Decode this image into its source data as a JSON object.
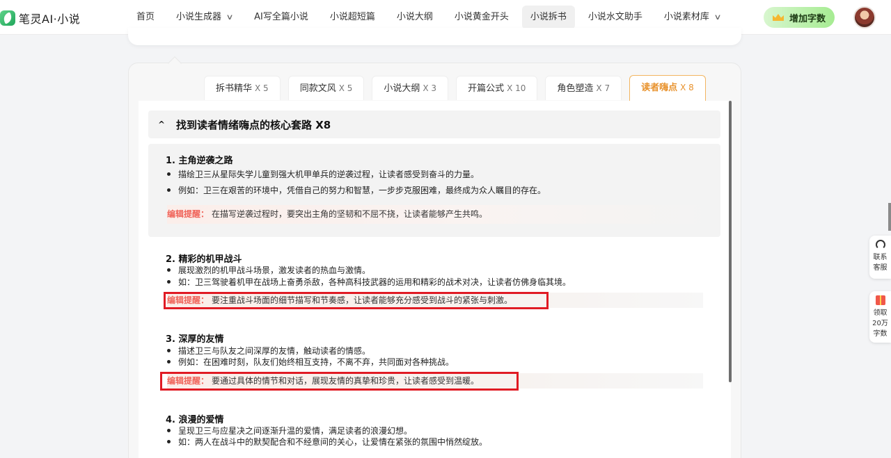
{
  "brand": {
    "name": "笔灵AI·小说"
  },
  "nav": {
    "items": [
      {
        "label": "首页",
        "dropdown": false,
        "active": false
      },
      {
        "label": "小说生成器",
        "dropdown": true,
        "active": false
      },
      {
        "label": "AI写全篇小说",
        "dropdown": false,
        "active": false
      },
      {
        "label": "小说超短篇",
        "dropdown": false,
        "active": false
      },
      {
        "label": "小说大纲",
        "dropdown": false,
        "active": false
      },
      {
        "label": "小说黄金开头",
        "dropdown": false,
        "active": false
      },
      {
        "label": "小说拆书",
        "dropdown": false,
        "active": true
      },
      {
        "label": "小说水文助手",
        "dropdown": false,
        "active": false
      },
      {
        "label": "小说素材库",
        "dropdown": true,
        "active": false
      }
    ],
    "add_words_label": "增加字数"
  },
  "tabs": [
    {
      "label": "拆书精华",
      "count": "X 5"
    },
    {
      "label": "同款文风",
      "count": "X 5"
    },
    {
      "label": "小说大纲",
      "count": "X 3"
    },
    {
      "label": "开篇公式",
      "count": "X 10"
    },
    {
      "label": "角色塑造",
      "count": "X 7"
    },
    {
      "label": "读者嗨点",
      "count": "X 8"
    }
  ],
  "section": {
    "collapse_symbol": "^",
    "title": "找到读者情绪嗨点的核心套路 X8"
  },
  "items": [
    {
      "title": "1. 主角逆袭之路",
      "bullets": [
        "描绘卫三从星际失学儿童到强大机甲单兵的逆袭过程，让读者感受到奋斗的力量。",
        "例如：卫三在艰苦的环境中，凭借自己的努力和智慧，一步步克服困难，最终成为众人瞩目的存在。"
      ],
      "tip_label": "编辑提醒：",
      "tip": "在描写逆袭过程时，要突出主角的坚韧和不屈不挠，让读者能够产生共鸣。"
    },
    {
      "title": "2. 精彩的机甲战斗",
      "bullets": [
        "展现激烈的机甲战斗场景，激发读者的热血与激情。",
        "如：卫三驾驶着机甲在战场上奋勇杀敌，各种高科技武器的运用和精彩的战术对决，让读者仿佛身临其境。"
      ],
      "tip_label": "编辑提醒：",
      "tip": "要注重战斗场面的细节描写和节奏感，让读者能够充分感受到战斗的紧张与刺激。"
    },
    {
      "title": "3. 深厚的友情",
      "bullets": [
        "描述卫三与队友之间深厚的友情，触动读者的情感。",
        "例如：在困难时刻，队友们始终相互支持，不离不弃，共同面对各种挑战。"
      ],
      "tip_label": "编辑提醒：",
      "tip": "要通过具体的情节和对话，展现友情的真挚和珍贵，让读者感受到温暖。"
    },
    {
      "title": "4. 浪漫的爱情",
      "bullets": [
        "呈现卫三与应星决之间逐渐升温的爱情，满足读者的浪漫幻想。",
        "如：两人在战斗中的默契配合和不经意间的关心，让爱情在紧张的氛围中悄然绽放。"
      ]
    }
  ],
  "side": {
    "service_label_1": "联系",
    "service_label_2": "客服",
    "gift_label_1": "领取",
    "gift_label_2": "20万",
    "gift_label_3": "字数"
  },
  "colors": {
    "accent_orange": "#e8922d",
    "tip_red": "#f0645a",
    "highlight_box": "#e01b24",
    "add_button_green": "#a6ec92"
  }
}
